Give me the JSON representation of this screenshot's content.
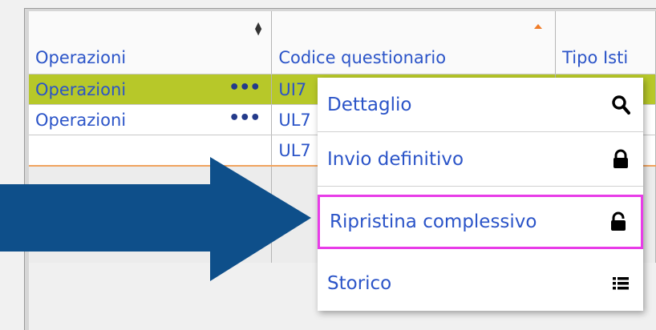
{
  "grid": {
    "columns": [
      {
        "label": "Operazioni",
        "sort": "both"
      },
      {
        "label": "Codice questionario",
        "sort": "asc"
      },
      {
        "label": "Tipo Isti",
        "sort": "none"
      }
    ],
    "rows": [
      {
        "operazioni": "Operazioni",
        "actions_glyph": "•••",
        "codice": "UI7",
        "selected": true
      },
      {
        "operazioni": "Operazioni",
        "actions_glyph": "•••",
        "codice": "UL7",
        "selected": false
      },
      {
        "operazioni": "",
        "actions_glyph": "",
        "codice": "UL7",
        "selected": false
      }
    ]
  },
  "context_menu": {
    "items": [
      {
        "label": "Dettaglio",
        "icon": "search-icon"
      },
      {
        "label": "Invio definitivo",
        "icon": "lock-icon"
      },
      {
        "label": "Ripristina complessivo",
        "icon": "unlock-icon",
        "highlighted": true
      },
      {
        "label": "Storico",
        "icon": "list-icon"
      }
    ]
  },
  "colors": {
    "link_text": "#2b54c8",
    "selected_row": "#b7c829",
    "highlight_border": "#e83ce8",
    "arrow_fill": "#0e4f8a",
    "sort_asc": "#f07c28"
  }
}
